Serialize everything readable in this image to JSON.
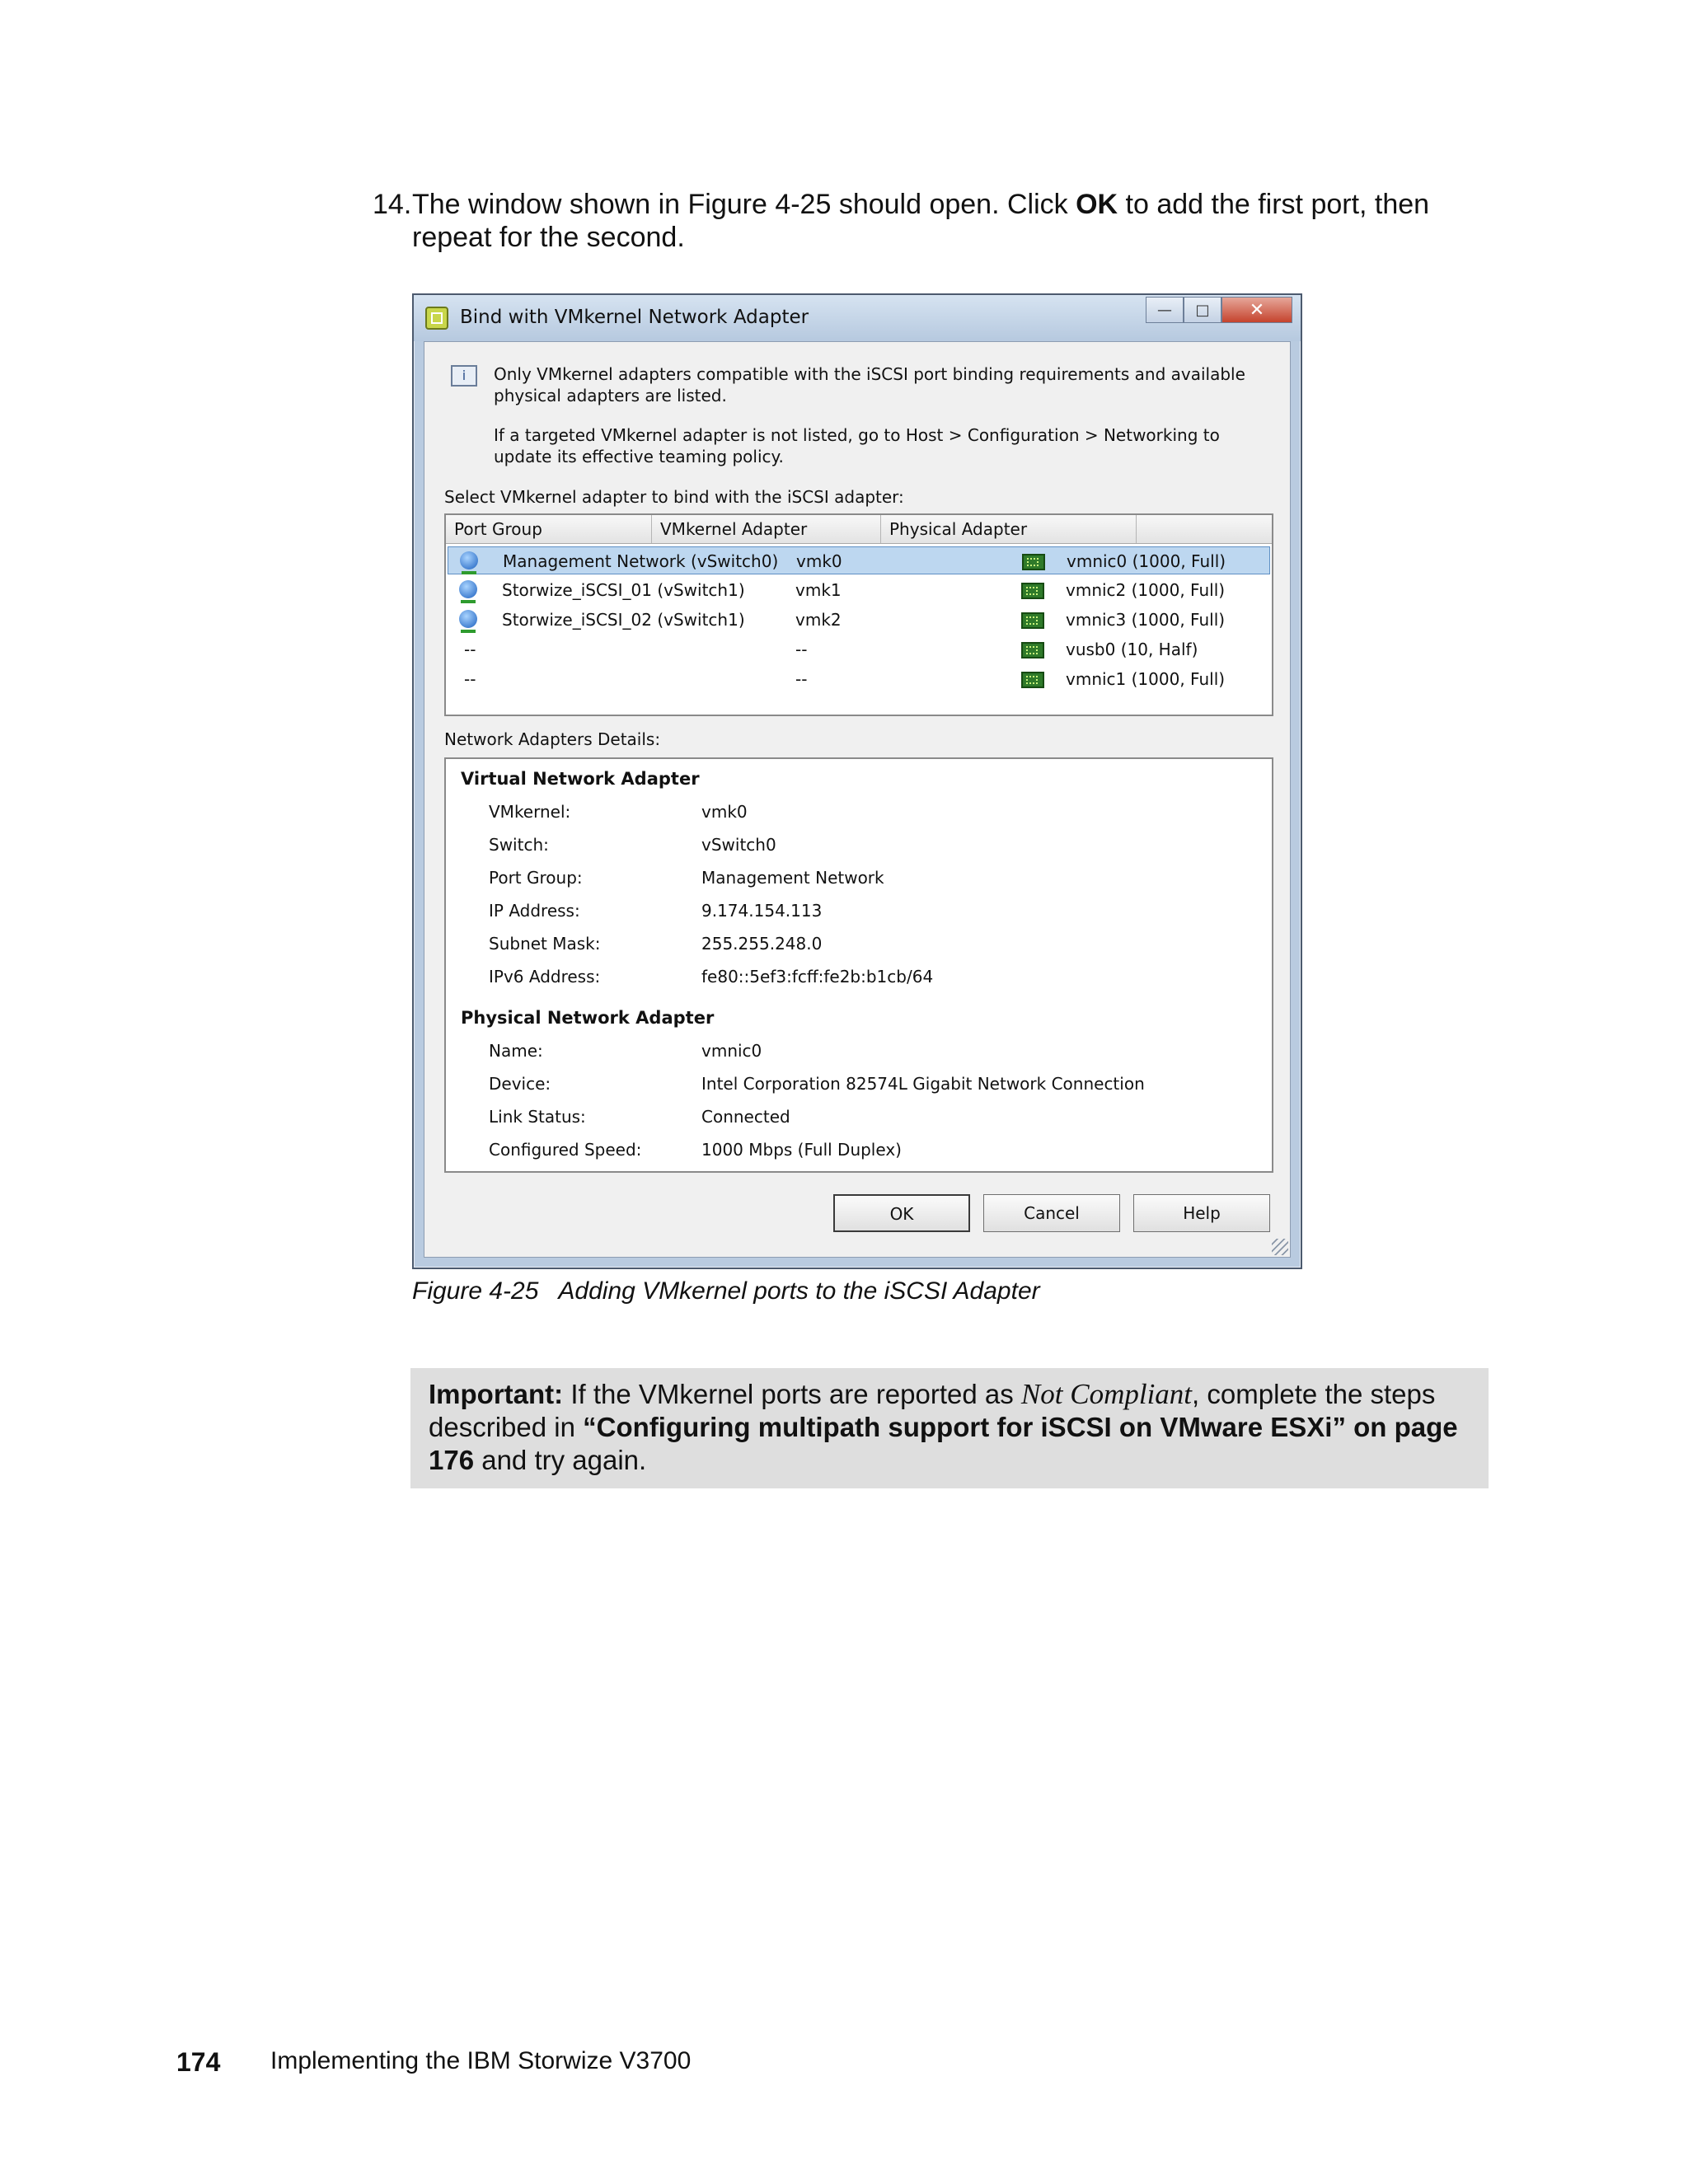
{
  "step": {
    "number": "14.",
    "text_before": "The window shown in Figure 4-25 should open. Click ",
    "ok_word": "OK",
    "text_after": " to add the first port, then repeat for the second."
  },
  "dialog": {
    "title": "Bind with VMkernel Network Adapter",
    "window_buttons": {
      "minimize": "—",
      "maximize": "□",
      "close": "✕"
    },
    "info_line1": "Only VMkernel adapters compatible with the iSCSI port binding requirements and available physical adapters are listed.",
    "info_line2": "If a targeted VMkernel adapter is not listed, go to Host > Configuration > Networking to update its effective teaming policy.",
    "select_label": "Select VMkernel adapter to bind with the iSCSI adapter:",
    "columns": {
      "port_group": "Port Group",
      "vmkernel_adapter": "VMkernel Adapter",
      "physical_adapter": "Physical Adapter"
    },
    "rows": [
      {
        "port_group": "Management Network (vSwitch0)",
        "vmk": "vmk0",
        "physical": "vmnic0 (1000, Full)",
        "selected": true
      },
      {
        "port_group": "Storwize_iSCSI_01 (vSwitch1)",
        "vmk": "vmk1",
        "physical": "vmnic2 (1000, Full)"
      },
      {
        "port_group": "Storwize_iSCSI_02 (vSwitch1)",
        "vmk": "vmk2",
        "physical": "vmnic3 (1000, Full)"
      },
      {
        "port_group": "--",
        "vmk": "--",
        "physical": "vusb0 (10, Half)"
      },
      {
        "port_group": "--",
        "vmk": "--",
        "physical": "vmnic1 (1000, Full)"
      }
    ],
    "details_label": "Network Adapters Details:",
    "virtual": {
      "heading": "Virtual Network Adapter",
      "fields": [
        {
          "label": "VMkernel:",
          "value": "vmk0"
        },
        {
          "label": "Switch:",
          "value": "vSwitch0"
        },
        {
          "label": "Port Group:",
          "value": "Management Network"
        },
        {
          "label": "IP Address:",
          "value": "9.174.154.113"
        },
        {
          "label": "Subnet Mask:",
          "value": "255.255.248.0"
        },
        {
          "label": "IPv6 Address:",
          "value": "fe80::5ef3:fcff:fe2b:b1cb/64"
        }
      ]
    },
    "physical": {
      "heading": "Physical Network Adapter",
      "fields": [
        {
          "label": "Name:",
          "value": "vmnic0"
        },
        {
          "label": "Device:",
          "value": "Intel Corporation 82574L Gigabit Network Connection"
        },
        {
          "label": "Link Status:",
          "value": "Connected"
        },
        {
          "label": "Configured Speed:",
          "value": "1000 Mbps (Full Duplex)"
        }
      ]
    },
    "buttons": {
      "ok": "OK",
      "cancel": "Cancel",
      "help": "Help"
    }
  },
  "caption": {
    "number": "Figure 4-25",
    "text": "Adding VMkernel ports to the iSCSI Adapter"
  },
  "important": {
    "label": "Important:",
    "text1": " If the VMkernel ports are reported as ",
    "emph": "Not Compliant",
    "text2": ", complete the steps described in ",
    "link": "“Configuring multipath support for iSCSI on VMware ESXi” on page 176",
    "text3": " and try again."
  },
  "footer": {
    "page": "174",
    "book": "Implementing the IBM Storwize V3700"
  }
}
